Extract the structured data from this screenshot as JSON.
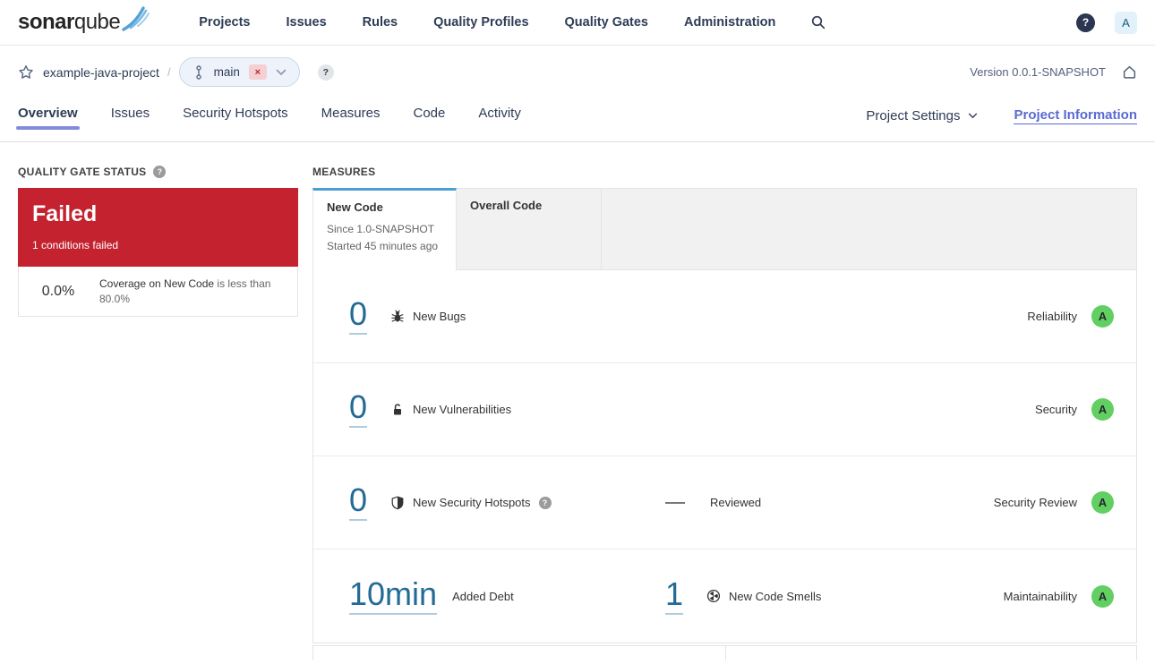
{
  "navbar": {
    "logo": {
      "bold": "sonar",
      "light": "qube"
    },
    "items": [
      "Projects",
      "Issues",
      "Rules",
      "Quality Profiles",
      "Quality Gates",
      "Administration"
    ],
    "help_label": "?",
    "avatar_letter": "A"
  },
  "project_header": {
    "project_name": "example-java-project",
    "separator": "/",
    "branch": {
      "name": "main",
      "remove_badge": "×"
    },
    "branch_help": "?",
    "version": "Version 0.0.1-SNAPSHOT"
  },
  "tabs": {
    "items": [
      "Overview",
      "Issues",
      "Security Hotspots",
      "Measures",
      "Code",
      "Activity"
    ],
    "active": "Overview",
    "project_settings": "Project Settings",
    "project_information": "Project Information"
  },
  "quality_gate": {
    "title": "QUALITY GATE STATUS",
    "help": "?",
    "status": "Failed",
    "conditions_summary": "1 conditions failed",
    "condition": {
      "value": "0.0%",
      "metric": "Coverage on New Code",
      "comparison": "is less than 80.0%"
    }
  },
  "measures": {
    "title": "MEASURES",
    "tabs": [
      {
        "label": "New Code",
        "line1": "Since 1.0-SNAPSHOT",
        "line2": "Started 45 minutes ago"
      },
      {
        "label": "Overall Code"
      }
    ],
    "rows": [
      {
        "value": "0",
        "icon": "bug-icon",
        "label": "New Bugs",
        "domain": "Reliability",
        "rating": "A"
      },
      {
        "value": "0",
        "icon": "lock-icon",
        "label": "New Vulnerabilities",
        "domain": "Security",
        "rating": "A"
      },
      {
        "value": "0",
        "icon": "shield-icon",
        "label": "New Security Hotspots",
        "help": "?",
        "reviewed_label": "Reviewed",
        "domain": "Security Review",
        "rating": "A"
      },
      {
        "value": "10min",
        "label": "Added Debt",
        "second_value": "1",
        "second_icon": "code-smell-icon",
        "second_label": "New Code Smells",
        "domain": "Maintainability",
        "rating": "A"
      }
    ]
  },
  "colors": {
    "failed_red": "#c3222e",
    "rating_green_a": "#62cf62",
    "measure_link_blue": "#236a97",
    "active_tab_accent": "#4b9fd5",
    "nav_underline_purple": "#828cd9",
    "project_information_link": "#5a6ad2"
  }
}
